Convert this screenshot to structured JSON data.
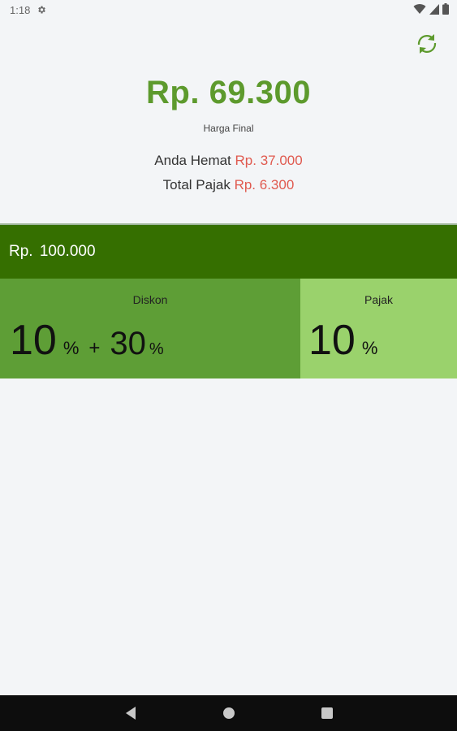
{
  "status_bar": {
    "time": "1:18",
    "icons": [
      "gear-icon",
      "wifi-icon",
      "signal-icon",
      "battery-icon"
    ]
  },
  "toolbar": {
    "refresh_icon": "refresh-icon"
  },
  "summary": {
    "final_price": "Rp. 69.300",
    "final_caption": "Harga Final",
    "savings_label": "Anda Hemat",
    "savings_value": "Rp. 37.000",
    "tax_label": "Total Pajak",
    "tax_value": "Rp. 6.300"
  },
  "base": {
    "price": "Rp. 100.000"
  },
  "discount": {
    "label": "Diskon",
    "value1": "10",
    "value2": "30",
    "percent_symbol": "%",
    "plus": "+"
  },
  "tax": {
    "label": "Pajak",
    "value": "10",
    "percent_symbol": "%"
  },
  "colors": {
    "primary": "#5d9a2d",
    "accent_red": "#e05a4f",
    "base_bar": "#356f00",
    "discount_panel": "#5e9e36",
    "tax_panel": "#9ad26c"
  },
  "nav_bar": {
    "icons": [
      "back-icon",
      "home-icon",
      "recents-icon"
    ]
  }
}
